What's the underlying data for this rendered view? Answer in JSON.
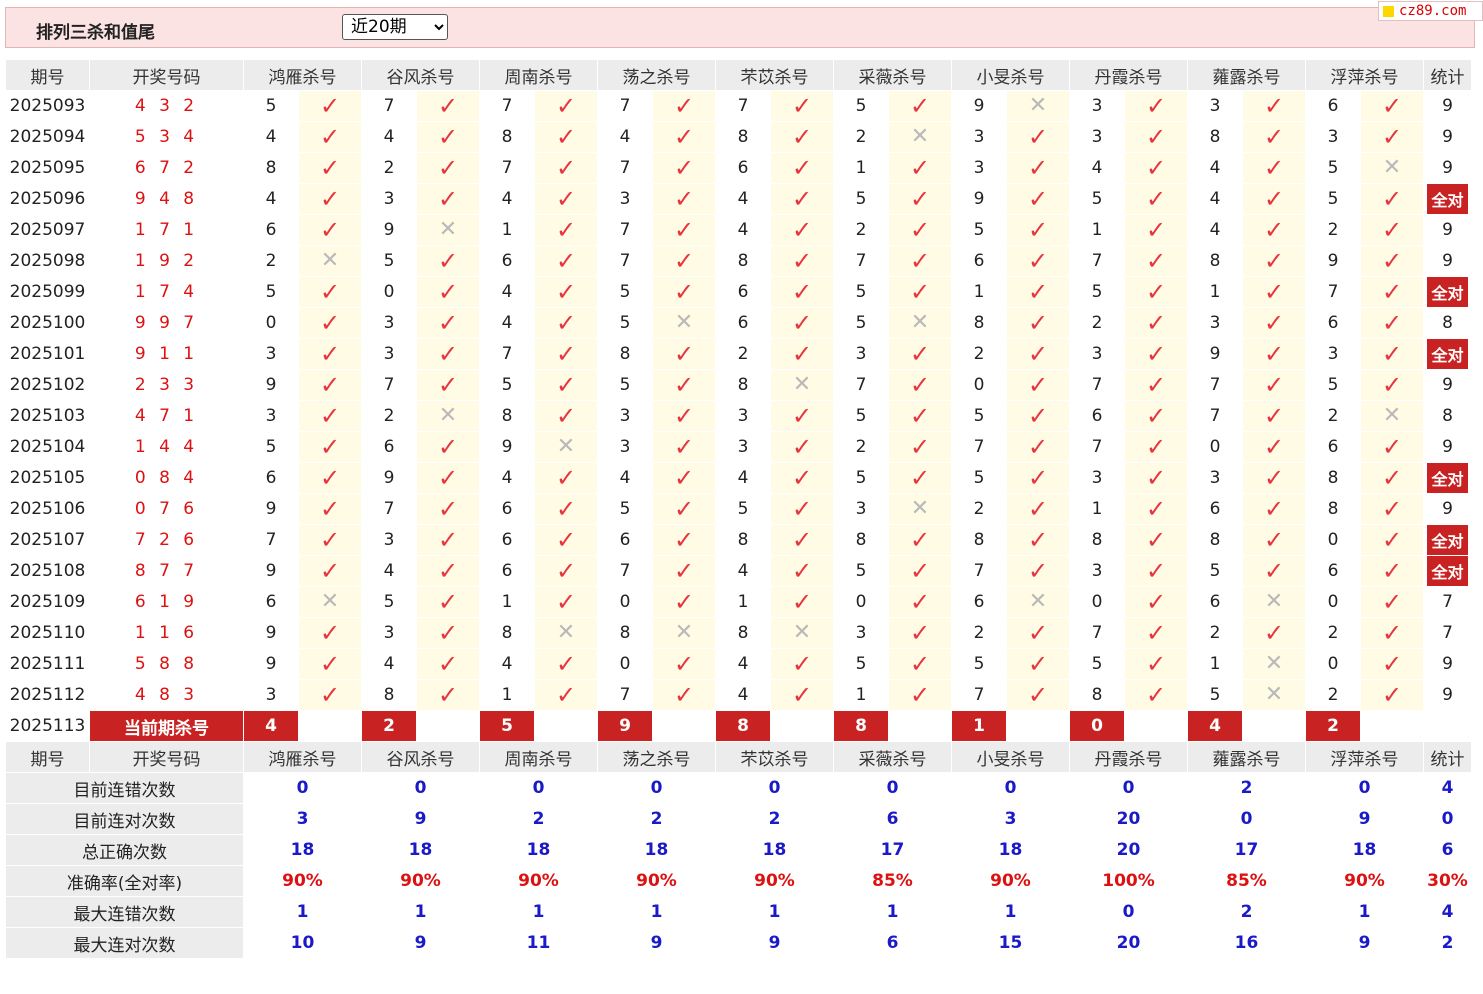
{
  "header": {
    "title": "排列三杀和值尾",
    "select_value": "近20期",
    "select_options": [
      "近20期"
    ],
    "logo_text": "cz89.com"
  },
  "colors": {
    "accent_red": "#c92222",
    "check_red": "#e8343e",
    "stat_blue": "#1a1ac8"
  },
  "table": {
    "col_issue": "期号",
    "col_code": "开奖号码",
    "experts": [
      "鸿雁杀号",
      "谷风杀号",
      "周南杀号",
      "荡之杀号",
      "芣苡杀号",
      "采薇杀号",
      "小旻杀号",
      "丹霞杀号",
      "蕹露杀号",
      "浮萍杀号"
    ],
    "col_stat": "统计",
    "rows": [
      {
        "issue": "2025093",
        "code": "4 3 2",
        "kills": [
          5,
          7,
          7,
          7,
          7,
          5,
          9,
          3,
          3,
          6
        ],
        "results": [
          1,
          1,
          1,
          1,
          1,
          1,
          0,
          1,
          1,
          1
        ],
        "stat": "9"
      },
      {
        "issue": "2025094",
        "code": "5 3 4",
        "kills": [
          4,
          4,
          8,
          4,
          8,
          2,
          3,
          3,
          8,
          3
        ],
        "results": [
          1,
          1,
          1,
          1,
          1,
          0,
          1,
          1,
          1,
          1
        ],
        "stat": "9"
      },
      {
        "issue": "2025095",
        "code": "6 7 2",
        "kills": [
          8,
          2,
          7,
          7,
          6,
          1,
          3,
          4,
          4,
          5
        ],
        "results": [
          1,
          1,
          1,
          1,
          1,
          1,
          1,
          1,
          1,
          0
        ],
        "stat": "9"
      },
      {
        "issue": "2025096",
        "code": "9 4 8",
        "kills": [
          4,
          3,
          4,
          3,
          4,
          5,
          9,
          5,
          4,
          5
        ],
        "results": [
          1,
          1,
          1,
          1,
          1,
          1,
          1,
          1,
          1,
          1
        ],
        "stat": "全对"
      },
      {
        "issue": "2025097",
        "code": "1 7 1",
        "kills": [
          6,
          9,
          1,
          7,
          4,
          2,
          5,
          1,
          4,
          2
        ],
        "results": [
          1,
          0,
          1,
          1,
          1,
          1,
          1,
          1,
          1,
          1
        ],
        "stat": "9"
      },
      {
        "issue": "2025098",
        "code": "1 9 2",
        "kills": [
          2,
          5,
          6,
          7,
          8,
          7,
          6,
          7,
          8,
          9
        ],
        "results": [
          0,
          1,
          1,
          1,
          1,
          1,
          1,
          1,
          1,
          1
        ],
        "stat": "9"
      },
      {
        "issue": "2025099",
        "code": "1 7 4",
        "kills": [
          5,
          0,
          4,
          5,
          6,
          5,
          1,
          5,
          1,
          7
        ],
        "results": [
          1,
          1,
          1,
          1,
          1,
          1,
          1,
          1,
          1,
          1
        ],
        "stat": "全对"
      },
      {
        "issue": "2025100",
        "code": "9 9 7",
        "kills": [
          0,
          3,
          4,
          5,
          6,
          5,
          8,
          2,
          3,
          6
        ],
        "results": [
          1,
          1,
          1,
          0,
          1,
          0,
          1,
          1,
          1,
          1
        ],
        "stat": "8"
      },
      {
        "issue": "2025101",
        "code": "9 1 1",
        "kills": [
          3,
          3,
          7,
          8,
          2,
          3,
          2,
          3,
          9,
          3
        ],
        "results": [
          1,
          1,
          1,
          1,
          1,
          1,
          1,
          1,
          1,
          1
        ],
        "stat": "全对"
      },
      {
        "issue": "2025102",
        "code": "2 3 3",
        "kills": [
          9,
          7,
          5,
          5,
          8,
          7,
          0,
          7,
          7,
          5
        ],
        "results": [
          1,
          1,
          1,
          1,
          0,
          1,
          1,
          1,
          1,
          1
        ],
        "stat": "9"
      },
      {
        "issue": "2025103",
        "code": "4 7 1",
        "kills": [
          3,
          2,
          8,
          3,
          3,
          5,
          5,
          6,
          7,
          2
        ],
        "results": [
          1,
          0,
          1,
          1,
          1,
          1,
          1,
          1,
          1,
          0
        ],
        "stat": "8"
      },
      {
        "issue": "2025104",
        "code": "1 4 4",
        "kills": [
          5,
          6,
          9,
          3,
          3,
          2,
          7,
          7,
          0,
          6
        ],
        "results": [
          1,
          1,
          0,
          1,
          1,
          1,
          1,
          1,
          1,
          1
        ],
        "stat": "9"
      },
      {
        "issue": "2025105",
        "code": "0 8 4",
        "kills": [
          6,
          9,
          4,
          4,
          4,
          5,
          5,
          3,
          3,
          8
        ],
        "results": [
          1,
          1,
          1,
          1,
          1,
          1,
          1,
          1,
          1,
          1
        ],
        "stat": "全对"
      },
      {
        "issue": "2025106",
        "code": "0 7 6",
        "kills": [
          9,
          7,
          6,
          5,
          5,
          3,
          2,
          1,
          6,
          8
        ],
        "results": [
          1,
          1,
          1,
          1,
          1,
          0,
          1,
          1,
          1,
          1
        ],
        "stat": "9"
      },
      {
        "issue": "2025107",
        "code": "7 2 6",
        "kills": [
          7,
          3,
          6,
          6,
          8,
          8,
          8,
          8,
          8,
          0
        ],
        "results": [
          1,
          1,
          1,
          1,
          1,
          1,
          1,
          1,
          1,
          1
        ],
        "stat": "全对"
      },
      {
        "issue": "2025108",
        "code": "8 7 7",
        "kills": [
          9,
          4,
          6,
          7,
          4,
          5,
          7,
          3,
          5,
          6
        ],
        "results": [
          1,
          1,
          1,
          1,
          1,
          1,
          1,
          1,
          1,
          1
        ],
        "stat": "全对"
      },
      {
        "issue": "2025109",
        "code": "6 1 9",
        "kills": [
          6,
          5,
          1,
          0,
          1,
          0,
          6,
          0,
          6,
          0
        ],
        "results": [
          0,
          1,
          1,
          1,
          1,
          1,
          0,
          1,
          0,
          1
        ],
        "stat": "7"
      },
      {
        "issue": "2025110",
        "code": "1 1 6",
        "kills": [
          9,
          3,
          8,
          8,
          8,
          3,
          2,
          7,
          2,
          2
        ],
        "results": [
          1,
          1,
          0,
          0,
          0,
          1,
          1,
          1,
          1,
          1
        ],
        "stat": "7"
      },
      {
        "issue": "2025111",
        "code": "5 8 8",
        "kills": [
          9,
          4,
          4,
          0,
          4,
          5,
          5,
          5,
          1,
          0
        ],
        "results": [
          1,
          1,
          1,
          1,
          1,
          1,
          1,
          1,
          0,
          1
        ],
        "stat": "9"
      },
      {
        "issue": "2025112",
        "code": "4 8 3",
        "kills": [
          3,
          8,
          1,
          7,
          4,
          1,
          7,
          8,
          5,
          2
        ],
        "results": [
          1,
          1,
          1,
          1,
          1,
          1,
          1,
          1,
          0,
          1
        ],
        "stat": "9"
      }
    ],
    "current": {
      "issue": "2025113",
      "label": "当前期杀号",
      "kills": [
        "4",
        "2",
        "5",
        "9",
        "8",
        "8",
        "1",
        "0",
        "4",
        "2"
      ]
    }
  },
  "stats": {
    "labels": [
      "目前连错次数",
      "目前连对次数",
      "总正确次数",
      "准确率(全对率)",
      "最大连错次数",
      "最大连对次数"
    ],
    "values": [
      [
        "0",
        "0",
        "0",
        "0",
        "0",
        "0",
        "0",
        "0",
        "2",
        "0"
      ],
      [
        "3",
        "9",
        "2",
        "2",
        "2",
        "6",
        "3",
        "20",
        "0",
        "9"
      ],
      [
        "18",
        "18",
        "18",
        "18",
        "18",
        "17",
        "18",
        "20",
        "17",
        "18"
      ],
      [
        "90%",
        "90%",
        "90%",
        "90%",
        "90%",
        "85%",
        "90%",
        "100%",
        "85%",
        "90%"
      ],
      [
        "1",
        "1",
        "1",
        "1",
        "1",
        "1",
        "1",
        "0",
        "2",
        "1"
      ],
      [
        "10",
        "9",
        "11",
        "9",
        "9",
        "6",
        "15",
        "20",
        "16",
        "9"
      ]
    ],
    "summary": [
      "4",
      "0",
      "6",
      "30%",
      "4",
      "2"
    ]
  }
}
